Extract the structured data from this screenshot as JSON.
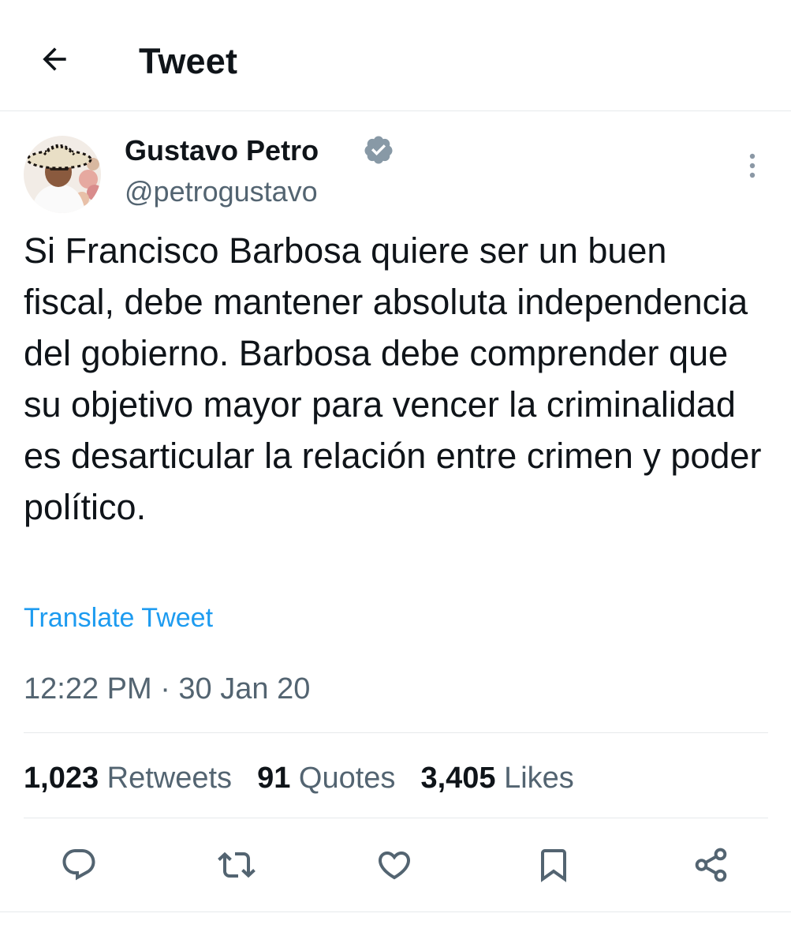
{
  "header": {
    "title": "Tweet",
    "back_icon": "arrow-left-icon"
  },
  "author": {
    "name": "Gustavo Petro",
    "handle": "@petrogustavo",
    "verified": true,
    "verified_color": "#8899a6"
  },
  "tweet": {
    "text": "Si Francisco Barbosa quiere ser un buen fiscal, debe mantener absoluta independencia del gobierno. Barbosa debe comprender que su objetivo mayor para vencer la criminalidad es desarticular la relación entre crimen y poder político.",
    "translate_label": "Translate Tweet",
    "timestamp": "12:22 PM · 30 Jan 20"
  },
  "stats": {
    "retweets": {
      "count": "1,023",
      "label": "Retweets"
    },
    "quotes": {
      "count": "91",
      "label": "Quotes"
    },
    "likes": {
      "count": "3,405",
      "label": "Likes"
    }
  },
  "actions": [
    "reply-icon",
    "retweet-icon",
    "like-icon",
    "bookmark-icon",
    "share-icon"
  ],
  "colors": {
    "link": "#1d9bf0",
    "secondary_text": "#536471",
    "primary_text": "#0f1419",
    "divider": "#e6e9eb"
  }
}
